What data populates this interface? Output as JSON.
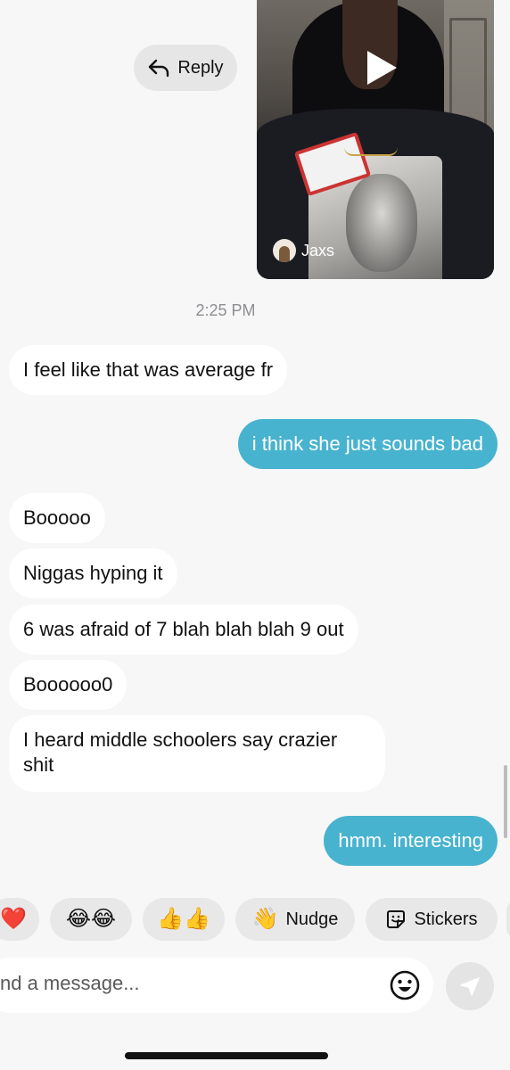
{
  "reply": {
    "label": "Reply"
  },
  "video": {
    "creator": "Jaxs"
  },
  "timestamp": "2:25 PM",
  "messages": [
    {
      "from": "them",
      "text": "I feel like that was average fr"
    },
    {
      "from": "me",
      "text": "i think she just sounds bad"
    },
    {
      "from": "them",
      "text": "Booooo"
    },
    {
      "from": "them",
      "text": "Niggas hyping it"
    },
    {
      "from": "them",
      "text": "6 was afraid of 7 blah blah blah 9 out"
    },
    {
      "from": "them",
      "text": "Boooooo0"
    },
    {
      "from": "them",
      "text": "I heard middle schoolers say crazier shit"
    },
    {
      "from": "me",
      "text": "hmm. interesting"
    }
  ],
  "reactions": {
    "heart": "❤️",
    "laugh": "😂😂",
    "thumbs": "👍👍",
    "nudge": "Nudge",
    "stickers": "Stickers"
  },
  "composer": {
    "placeholder": "nd a message..."
  },
  "colors": {
    "outgoing_bubble": "#48b3cf",
    "incoming_bubble": "#ffffff",
    "background": "#f7f7f7"
  }
}
